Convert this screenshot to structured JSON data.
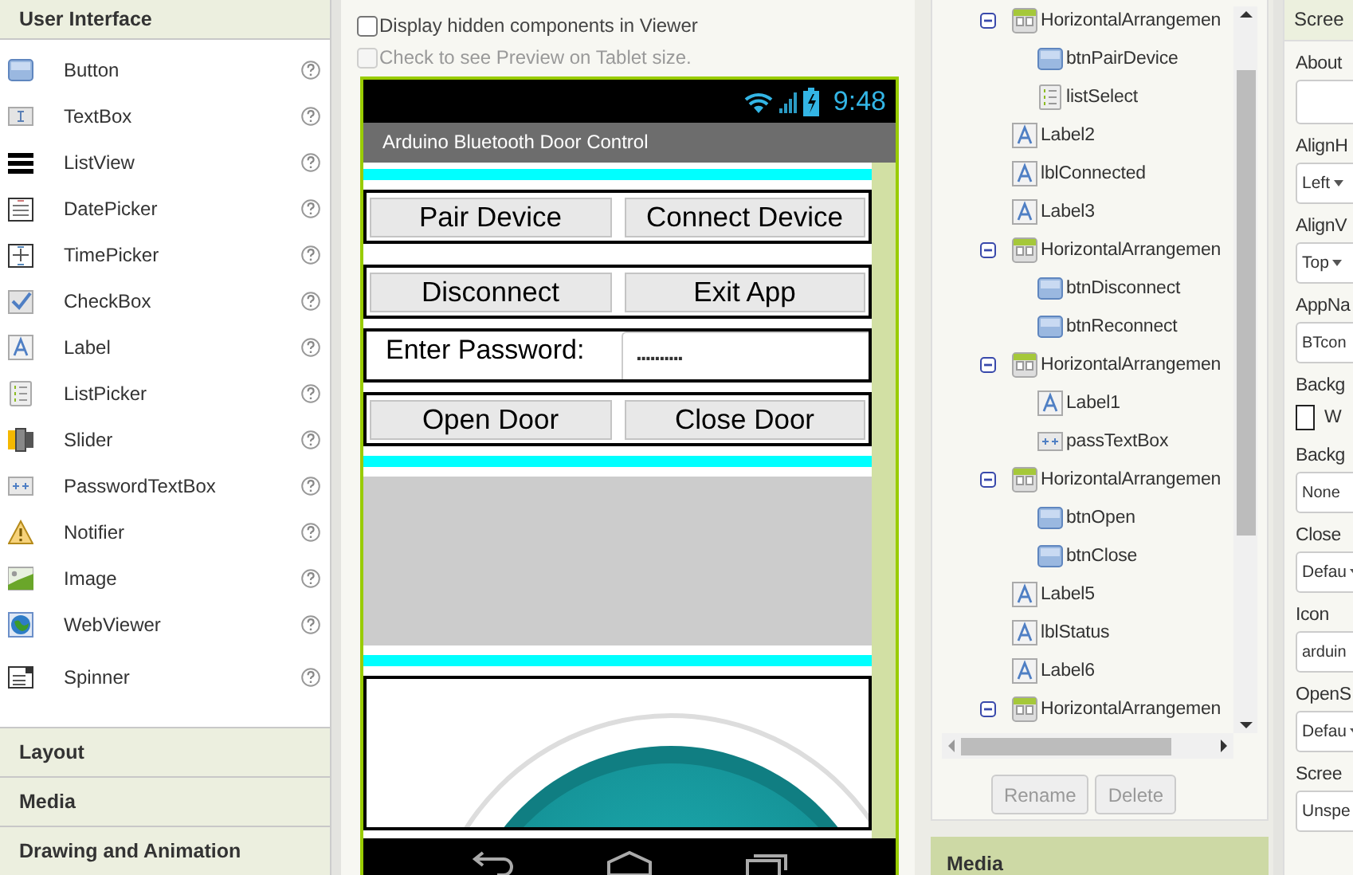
{
  "palette": {
    "title": "User Interface",
    "items": [
      {
        "kind": "button",
        "label": "Button"
      },
      {
        "kind": "textbox",
        "label": "TextBox"
      },
      {
        "kind": "listview",
        "label": "ListView"
      },
      {
        "kind": "datepicker",
        "label": "DatePicker"
      },
      {
        "kind": "timepicker",
        "label": "TimePicker"
      },
      {
        "kind": "checkbox",
        "label": "CheckBox"
      },
      {
        "kind": "label",
        "label": "Label"
      },
      {
        "kind": "listpicker",
        "label": "ListPicker"
      },
      {
        "kind": "slider",
        "label": "Slider"
      },
      {
        "kind": "password",
        "label": "PasswordTextBox"
      },
      {
        "kind": "notifier",
        "label": "Notifier"
      },
      {
        "kind": "image",
        "label": "Image"
      },
      {
        "kind": "webviewer",
        "label": "WebViewer"
      },
      {
        "kind": "spinner",
        "label": "Spinner"
      }
    ],
    "sections": [
      "Layout",
      "Media",
      "Drawing and Animation"
    ]
  },
  "viewer": {
    "options": [
      {
        "label": "Display hidden components in Viewer",
        "checked": false,
        "disabled": false
      },
      {
        "label": "Check to see Preview on Tablet size.",
        "checked": false,
        "disabled": true
      }
    ],
    "phone": {
      "time": "9:48",
      "title": "Arduino Bluetooth Door Control",
      "rows": [
        {
          "kind": "divider"
        },
        {
          "kind": "buttons",
          "buttons": [
            "Pair Device",
            "Connect Device"
          ]
        },
        {
          "kind": "spacer"
        },
        {
          "kind": "buttons",
          "buttons": [
            "Disconnect",
            "Exit App"
          ]
        },
        {
          "kind": "password",
          "label": "Enter Password:",
          "value": ".........."
        },
        {
          "kind": "buttons",
          "buttons": [
            "Open Door",
            "Close Door"
          ]
        },
        {
          "kind": "divider"
        },
        {
          "kind": "block"
        },
        {
          "kind": "divider"
        },
        {
          "kind": "image"
        }
      ]
    }
  },
  "components": {
    "tree": [
      {
        "kind": "arrangement",
        "name": "HorizontalArrangemen",
        "expanded": true,
        "children": [
          {
            "kind": "button",
            "name": "btnPairDevice"
          },
          {
            "kind": "listpicker",
            "name": "listSelect"
          }
        ]
      },
      {
        "kind": "label",
        "name": "Label2"
      },
      {
        "kind": "label",
        "name": "lblConnected"
      },
      {
        "kind": "label",
        "name": "Label3"
      },
      {
        "kind": "arrangement",
        "name": "HorizontalArrangemen",
        "expanded": true,
        "children": [
          {
            "kind": "button",
            "name": "btnDisconnect"
          },
          {
            "kind": "button",
            "name": "btnReconnect"
          }
        ]
      },
      {
        "kind": "arrangement",
        "name": "HorizontalArrangemen",
        "expanded": true,
        "children": [
          {
            "kind": "label",
            "name": "Label1"
          },
          {
            "kind": "password",
            "name": "passTextBox"
          }
        ]
      },
      {
        "kind": "arrangement",
        "name": "HorizontalArrangemen",
        "expanded": true,
        "children": [
          {
            "kind": "button",
            "name": "btnOpen"
          },
          {
            "kind": "button",
            "name": "btnClose"
          }
        ]
      },
      {
        "kind": "label",
        "name": "Label5"
      },
      {
        "kind": "label",
        "name": "lblStatus"
      },
      {
        "kind": "label",
        "name": "Label6"
      },
      {
        "kind": "arrangement",
        "name": "HorizontalArrangemen",
        "expanded": true
      }
    ],
    "buttons": [
      {
        "label": "Rename",
        "disabled": true
      },
      {
        "label": "Delete",
        "disabled": true
      }
    ],
    "next_section": "Media"
  },
  "properties": {
    "title": "Scree",
    "items": [
      {
        "label": "About",
        "kind": "textarea"
      },
      {
        "label": "AlignH",
        "kind": "select",
        "value": "Left"
      },
      {
        "label": "AlignV",
        "kind": "select",
        "value": "Top"
      },
      {
        "label": "AppNa",
        "kind": "text",
        "value": "BTcon"
      },
      {
        "label": "Backg",
        "kind": "color",
        "value": "W"
      },
      {
        "label": "Backg",
        "kind": "text",
        "value": "None"
      },
      {
        "label": "Close",
        "kind": "select",
        "value": "Defau"
      },
      {
        "label": "Icon",
        "kind": "text",
        "value": "arduin"
      },
      {
        "label": "OpenS",
        "kind": "select",
        "value": "Defau"
      },
      {
        "label": "Scree",
        "kind": "select",
        "value": "Unspe"
      }
    ]
  }
}
